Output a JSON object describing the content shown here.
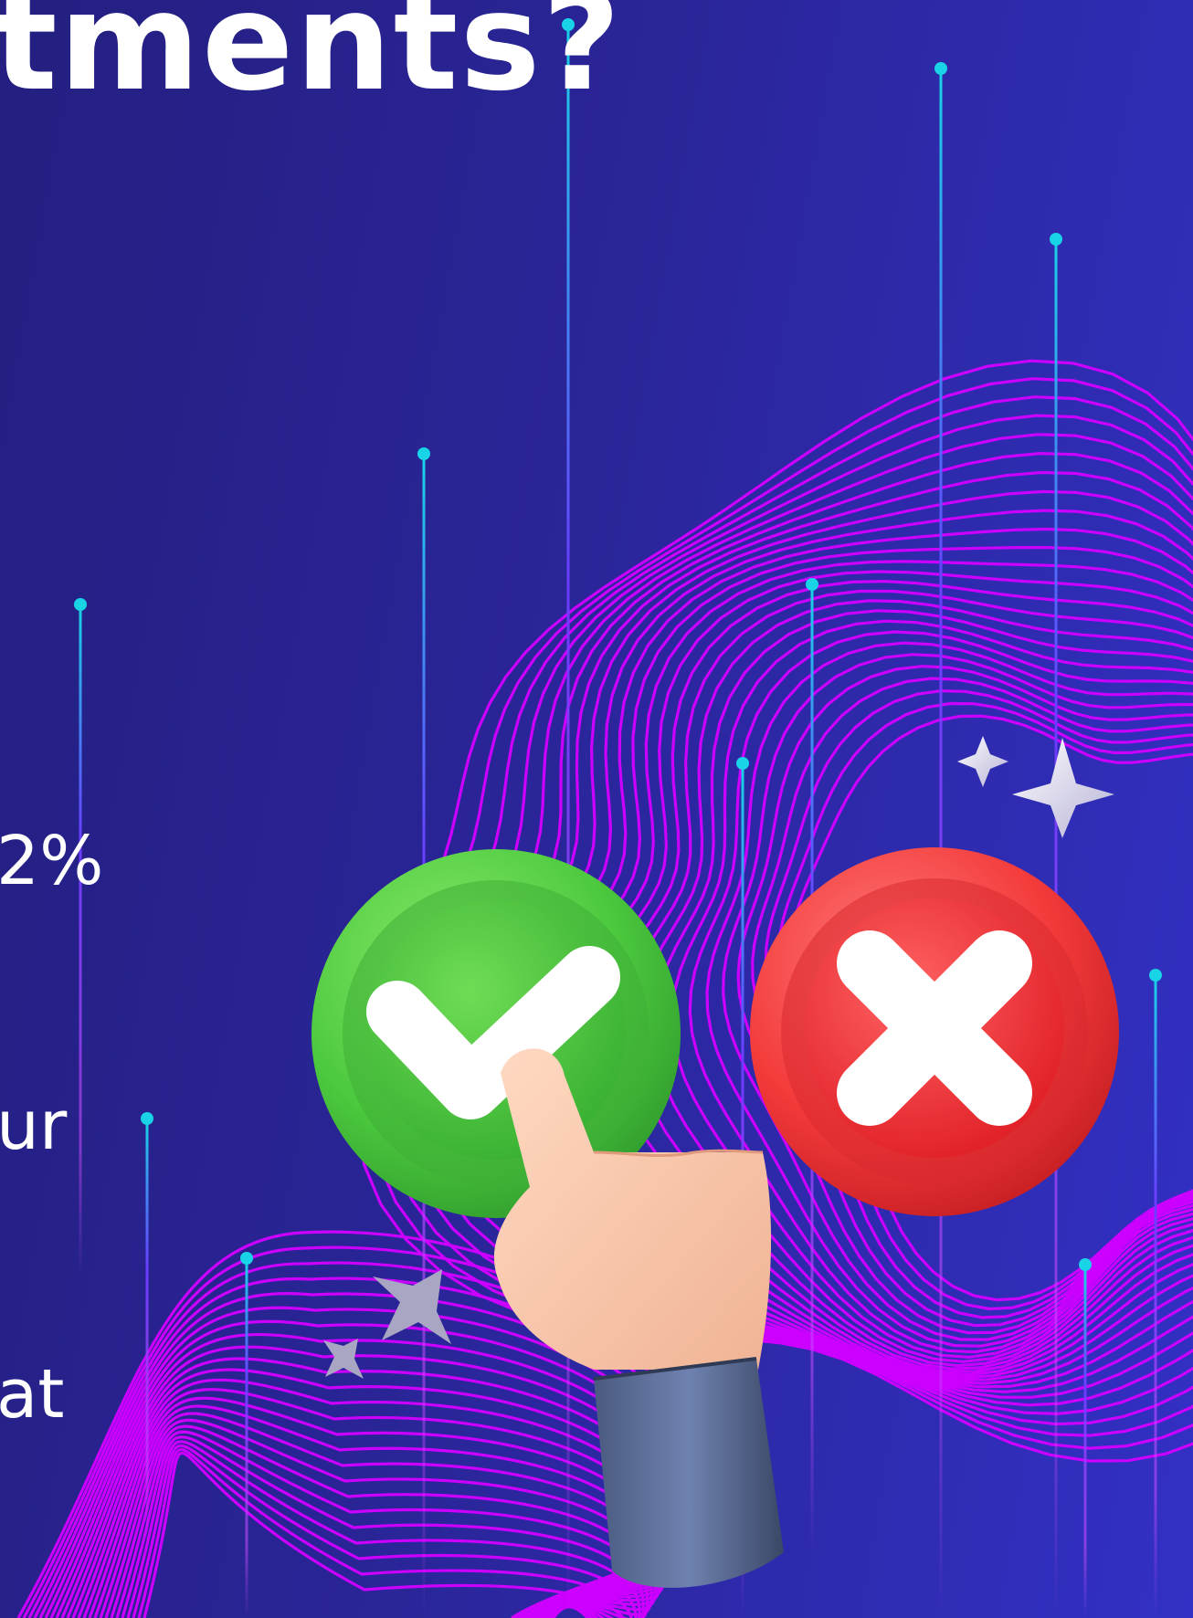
{
  "headline": {
    "text": "tments?"
  },
  "cutoff_text": [
    "2%",
    "ur",
    "at"
  ],
  "icons": {
    "approve": "check-button-icon",
    "reject": "x-button-icon",
    "pointer": "pointing-hand-icon",
    "sparkle": "sparkle-icon"
  },
  "colors": {
    "background_left": "#241f80",
    "background_right": "#3230c4",
    "wave_lines": "#cc00ff",
    "beam_tip": "#19d3e6",
    "approve_green": "#4cc93e",
    "reject_red": "#f33a3a",
    "text": "#ffffff"
  }
}
